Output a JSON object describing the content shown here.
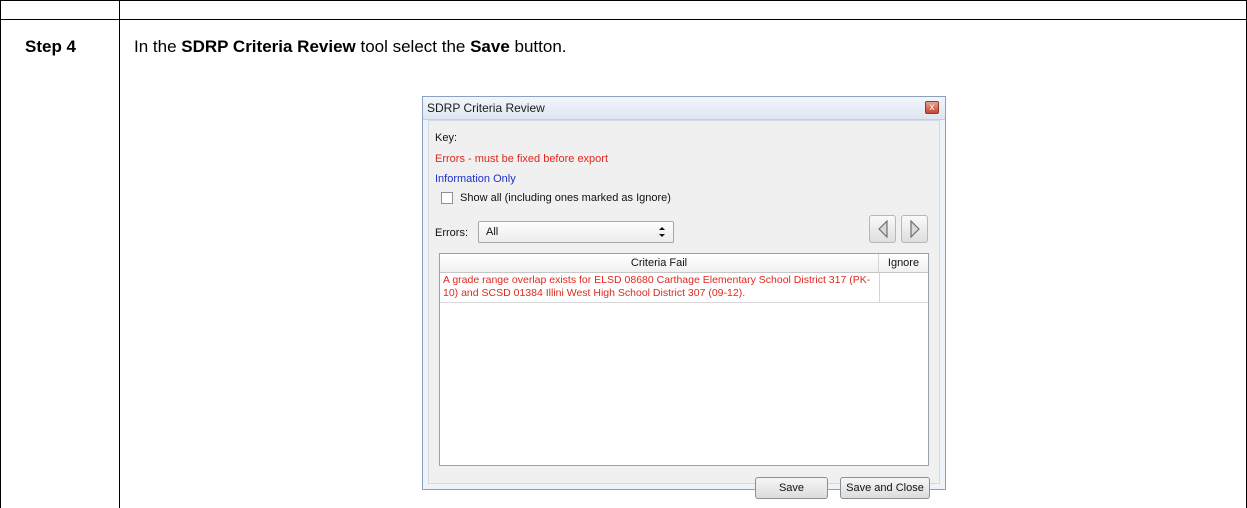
{
  "step": {
    "label": "Step 4",
    "instruction_prefix": "In the ",
    "instruction_tool": "SDRP Criteria Review",
    "instruction_mid": " tool select the ",
    "instruction_button": "Save",
    "instruction_suffix": " button."
  },
  "dialog": {
    "title": "SDRP Criteria Review",
    "close_glyph": "x",
    "key_label": "Key:",
    "error_legend": "Errors - must be fixed before export",
    "info_legend": "Information Only",
    "show_all_label": "Show all (including ones marked as Ignore)",
    "show_all_checked": false,
    "errors_label": "Errors:",
    "errors_filter_value": "All",
    "grid": {
      "columns": [
        "Criteria Fail",
        "Ignore"
      ],
      "rows": [
        {
          "criteria": "A grade range overlap exists for ELSD 08680 Carthage Elementary School District 317 (PK-10) and SCSD 01384 Illini West High School District 307 (09-12).",
          "ignore": ""
        }
      ]
    },
    "buttons": {
      "save": "Save",
      "save_and_close": "Save and Close"
    },
    "icons": {
      "close": "close-icon",
      "prev": "previous-arrow-icon",
      "next": "next-arrow-icon",
      "dropdown": "dropdown-arrows-icon"
    },
    "colors": {
      "error_text": "#e0281e",
      "info_text": "#1f2fc8"
    }
  }
}
